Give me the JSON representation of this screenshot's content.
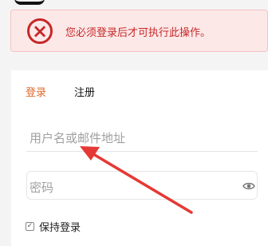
{
  "alert": {
    "icon": "x-circle-icon",
    "message": "您必须登录后才可执行此操作。",
    "color": "#c62828"
  },
  "tabs": [
    {
      "label": "登录",
      "active": true
    },
    {
      "label": "注册",
      "active": false
    }
  ],
  "form": {
    "username_placeholder": "用户名或邮件地址",
    "password_placeholder": "密码",
    "password_toggle_icon": "eye-icon",
    "remember_label": "保持登录"
  },
  "annotation": {
    "icon": "arrow-annotation",
    "color": "#e53935"
  }
}
